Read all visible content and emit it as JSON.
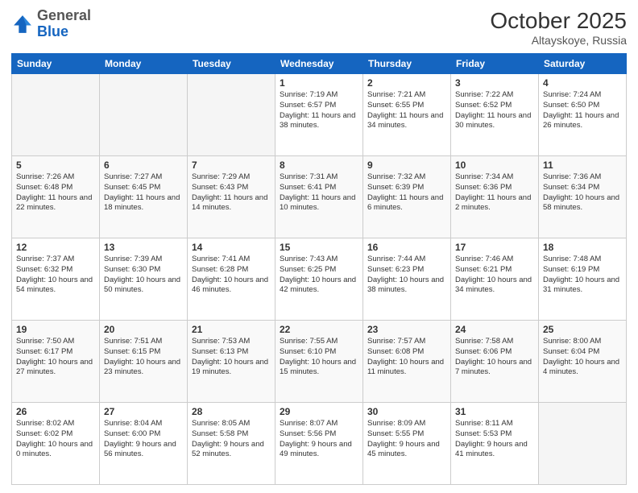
{
  "header": {
    "logo_general": "General",
    "logo_blue": "Blue",
    "month": "October 2025",
    "location": "Altayskoye, Russia"
  },
  "days_of_week": [
    "Sunday",
    "Monday",
    "Tuesday",
    "Wednesday",
    "Thursday",
    "Friday",
    "Saturday"
  ],
  "weeks": [
    [
      {
        "day": "",
        "text": ""
      },
      {
        "day": "",
        "text": ""
      },
      {
        "day": "",
        "text": ""
      },
      {
        "day": "1",
        "text": "Sunrise: 7:19 AM\nSunset: 6:57 PM\nDaylight: 11 hours and 38 minutes."
      },
      {
        "day": "2",
        "text": "Sunrise: 7:21 AM\nSunset: 6:55 PM\nDaylight: 11 hours and 34 minutes."
      },
      {
        "day": "3",
        "text": "Sunrise: 7:22 AM\nSunset: 6:52 PM\nDaylight: 11 hours and 30 minutes."
      },
      {
        "day": "4",
        "text": "Sunrise: 7:24 AM\nSunset: 6:50 PM\nDaylight: 11 hours and 26 minutes."
      }
    ],
    [
      {
        "day": "5",
        "text": "Sunrise: 7:26 AM\nSunset: 6:48 PM\nDaylight: 11 hours and 22 minutes."
      },
      {
        "day": "6",
        "text": "Sunrise: 7:27 AM\nSunset: 6:45 PM\nDaylight: 11 hours and 18 minutes."
      },
      {
        "day": "7",
        "text": "Sunrise: 7:29 AM\nSunset: 6:43 PM\nDaylight: 11 hours and 14 minutes."
      },
      {
        "day": "8",
        "text": "Sunrise: 7:31 AM\nSunset: 6:41 PM\nDaylight: 11 hours and 10 minutes."
      },
      {
        "day": "9",
        "text": "Sunrise: 7:32 AM\nSunset: 6:39 PM\nDaylight: 11 hours and 6 minutes."
      },
      {
        "day": "10",
        "text": "Sunrise: 7:34 AM\nSunset: 6:36 PM\nDaylight: 11 hours and 2 minutes."
      },
      {
        "day": "11",
        "text": "Sunrise: 7:36 AM\nSunset: 6:34 PM\nDaylight: 10 hours and 58 minutes."
      }
    ],
    [
      {
        "day": "12",
        "text": "Sunrise: 7:37 AM\nSunset: 6:32 PM\nDaylight: 10 hours and 54 minutes."
      },
      {
        "day": "13",
        "text": "Sunrise: 7:39 AM\nSunset: 6:30 PM\nDaylight: 10 hours and 50 minutes."
      },
      {
        "day": "14",
        "text": "Sunrise: 7:41 AM\nSunset: 6:28 PM\nDaylight: 10 hours and 46 minutes."
      },
      {
        "day": "15",
        "text": "Sunrise: 7:43 AM\nSunset: 6:25 PM\nDaylight: 10 hours and 42 minutes."
      },
      {
        "day": "16",
        "text": "Sunrise: 7:44 AM\nSunset: 6:23 PM\nDaylight: 10 hours and 38 minutes."
      },
      {
        "day": "17",
        "text": "Sunrise: 7:46 AM\nSunset: 6:21 PM\nDaylight: 10 hours and 34 minutes."
      },
      {
        "day": "18",
        "text": "Sunrise: 7:48 AM\nSunset: 6:19 PM\nDaylight: 10 hours and 31 minutes."
      }
    ],
    [
      {
        "day": "19",
        "text": "Sunrise: 7:50 AM\nSunset: 6:17 PM\nDaylight: 10 hours and 27 minutes."
      },
      {
        "day": "20",
        "text": "Sunrise: 7:51 AM\nSunset: 6:15 PM\nDaylight: 10 hours and 23 minutes."
      },
      {
        "day": "21",
        "text": "Sunrise: 7:53 AM\nSunset: 6:13 PM\nDaylight: 10 hours and 19 minutes."
      },
      {
        "day": "22",
        "text": "Sunrise: 7:55 AM\nSunset: 6:10 PM\nDaylight: 10 hours and 15 minutes."
      },
      {
        "day": "23",
        "text": "Sunrise: 7:57 AM\nSunset: 6:08 PM\nDaylight: 10 hours and 11 minutes."
      },
      {
        "day": "24",
        "text": "Sunrise: 7:58 AM\nSunset: 6:06 PM\nDaylight: 10 hours and 7 minutes."
      },
      {
        "day": "25",
        "text": "Sunrise: 8:00 AM\nSunset: 6:04 PM\nDaylight: 10 hours and 4 minutes."
      }
    ],
    [
      {
        "day": "26",
        "text": "Sunrise: 8:02 AM\nSunset: 6:02 PM\nDaylight: 10 hours and 0 minutes."
      },
      {
        "day": "27",
        "text": "Sunrise: 8:04 AM\nSunset: 6:00 PM\nDaylight: 9 hours and 56 minutes."
      },
      {
        "day": "28",
        "text": "Sunrise: 8:05 AM\nSunset: 5:58 PM\nDaylight: 9 hours and 52 minutes."
      },
      {
        "day": "29",
        "text": "Sunrise: 8:07 AM\nSunset: 5:56 PM\nDaylight: 9 hours and 49 minutes."
      },
      {
        "day": "30",
        "text": "Sunrise: 8:09 AM\nSunset: 5:55 PM\nDaylight: 9 hours and 45 minutes."
      },
      {
        "day": "31",
        "text": "Sunrise: 8:11 AM\nSunset: 5:53 PM\nDaylight: 9 hours and 41 minutes."
      },
      {
        "day": "",
        "text": ""
      }
    ]
  ]
}
